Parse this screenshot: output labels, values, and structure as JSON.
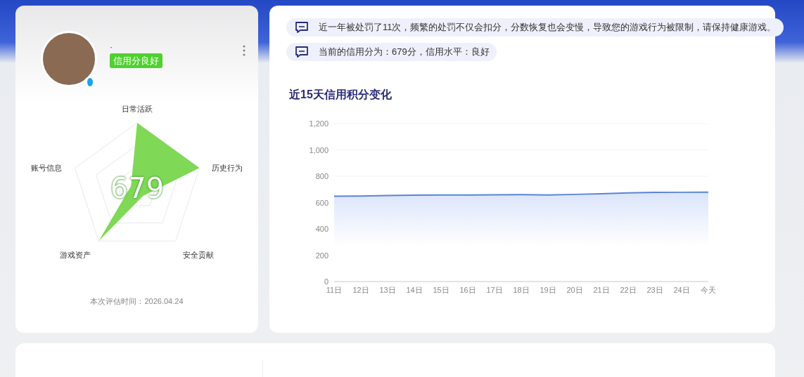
{
  "profile": {
    "name": "·",
    "badge": "信用分良好",
    "score": "679",
    "radar_labels": [
      "日常活跃",
      "历史行为",
      "安全贡献",
      "游戏资产",
      "账号信息"
    ],
    "eval_time": "本次评估时间：2026.04.24"
  },
  "notices": [
    "近一年被处罚了11次，频繁的处罚不仅会扣分，分数恢复也会变慢，导致您的游戏行为被限制，请保持健康游戏。",
    "当前的信用分为：679分，信用水平：良好"
  ],
  "trend": {
    "title": "近15天信用积分变化",
    "chart_data": {
      "type": "area",
      "categories": [
        "11日",
        "12日",
        "13日",
        "14日",
        "15日",
        "16日",
        "17日",
        "18日",
        "19日",
        "20日",
        "21日",
        "22日",
        "23日",
        "24日",
        "今天"
      ],
      "series": [
        {
          "color": "#5b84d6",
          "values": [
            648,
            649,
            653,
            656,
            657,
            657,
            659,
            660,
            658,
            662,
            667,
            673,
            677,
            678,
            679
          ]
        }
      ],
      "ylim": [
        0,
        1200
      ],
      "yticks": [
        0,
        200,
        400,
        600,
        800,
        {
          "value": 1000,
          "label": "1,000"
        },
        {
          "value": 1200,
          "label": "1,200"
        }
      ]
    }
  }
}
